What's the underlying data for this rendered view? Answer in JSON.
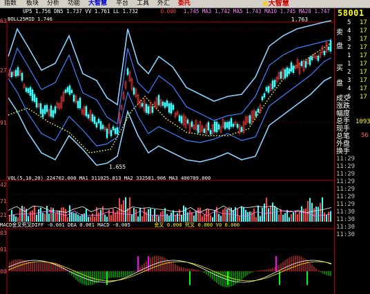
{
  "menu": {
    "items": [
      "指数",
      "板块",
      "分析",
      "功能",
      "大智慧",
      "平台",
      "工具",
      "外汇",
      "委托"
    ]
  },
  "logo": "大智慧",
  "infobar": {
    "text": "UP5 1.756 DN5 1.737 VV 1.761 LL 1.732",
    "right_text": "0.000",
    "ma_text": "1.745 MA3 1.742 MA5 1.743 MA10 1.745 MA20 1.747"
  },
  "bollbar": {
    "text": "BOLL25MID 1.746"
  },
  "axes": {
    "price_left": [
      "63",
      "27",
      "91"
    ],
    "vol_left": [
      "42",
      "71",
      "21"
    ],
    "macd_left": [
      "03",
      "01",
      "00"
    ]
  },
  "annotations": {
    "high": "1.763",
    "low": "1.655"
  },
  "volbar": {
    "text": "VOL(5,10,20)  224702.000 MA1 311025.813 MA2 332581.906 MA3 400709.000"
  },
  "macdbar": {
    "text": "MACD金叉死叉DIFF -0.001 DEA 0.001 MACD -0.005",
    "tail": "金叉 0.000 死叉 0.000 V0 0.000"
  },
  "rightpanel": {
    "code": "58001",
    "labels": [
      "卖",
      "盘",
      "买",
      "盘",
      "成交",
      "涨跌",
      "幅度",
      "总手",
      "现手",
      "总笔",
      "外盘",
      "换手"
    ],
    "numbers": [
      "5",
      "4",
      "3",
      "2",
      "1",
      "1",
      "2",
      "3",
      "4",
      "5"
    ],
    "vols": [
      "17",
      "17",
      "17",
      "17",
      "17",
      "17",
      "17",
      "17",
      "17",
      "17"
    ],
    "price_small": "1093",
    "percent": "56",
    "times": [
      "11:29",
      "11:29",
      "11:29",
      "11:29",
      "11:29",
      "11:29",
      "11:29",
      "11:30",
      "11:30",
      "11:30",
      "11:30"
    ]
  },
  "colors": {
    "upper_band": "#8ad4ff",
    "lower_band": "#8ad4ff",
    "ma": "#ffff60",
    "candle_up": "#ff4040",
    "candle_down": "#40ffff",
    "macd_pos": "#ff4040",
    "macd_neg": "#00ff00",
    "accent": "#c00000"
  }
}
